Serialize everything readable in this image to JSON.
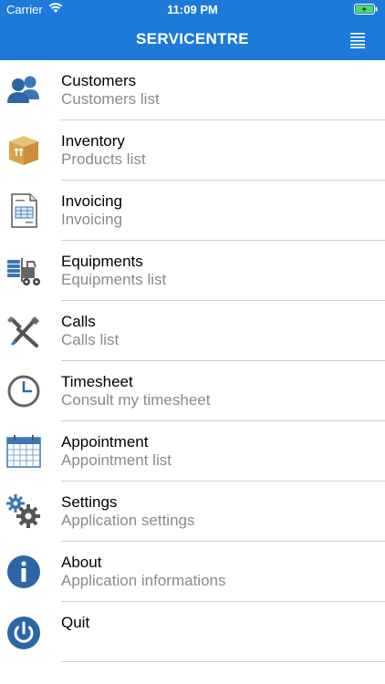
{
  "status_bar": {
    "carrier": "Carrier",
    "time": "11:09 PM"
  },
  "nav": {
    "title": "SERVICENTRE",
    "menu_icon": "hamburger-list-icon"
  },
  "colors": {
    "accent": "#1e7ad8",
    "icon_blue": "#2f6fb3",
    "subtitle": "#8a8a8a",
    "separator": "#cfcfcf"
  },
  "menu": [
    {
      "label": "Customers",
      "sub": "Customers list",
      "icon": "users-icon"
    },
    {
      "label": "Inventory",
      "sub": "Products list",
      "icon": "box-icon"
    },
    {
      "label": "Invoicing",
      "sub": "Invoicing",
      "icon": "invoice-icon"
    },
    {
      "label": "Equipments",
      "sub": "Equipments list",
      "icon": "forklift-icon"
    },
    {
      "label": "Calls",
      "sub": "Calls list",
      "icon": "tools-icon"
    },
    {
      "label": "Timesheet",
      "sub": "Consult my timesheet",
      "icon": "clock-icon"
    },
    {
      "label": "Appointment",
      "sub": "Appointment list",
      "icon": "calendar-icon"
    },
    {
      "label": "Settings",
      "sub": "Application settings",
      "icon": "gears-icon"
    },
    {
      "label": "About",
      "sub": "Application informations",
      "icon": "info-icon"
    },
    {
      "label": "Quit",
      "sub": "",
      "icon": "power-icon"
    }
  ]
}
